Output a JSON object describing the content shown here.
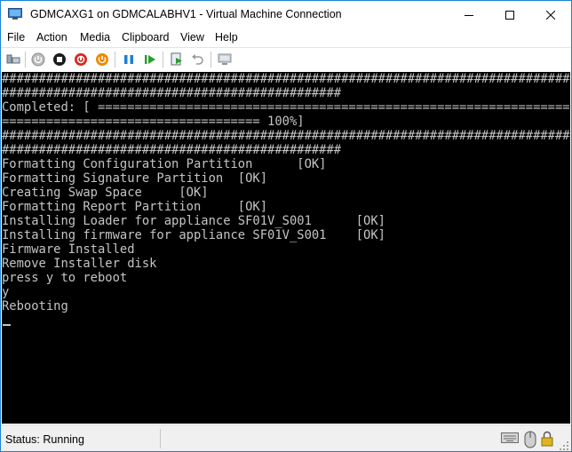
{
  "window": {
    "title": "GDMCAXG1 on GDMCALABHV1 - Virtual Machine Connection",
    "accent": "#1883d7"
  },
  "menu": {
    "items": [
      "File",
      "Action",
      "Media",
      "Clipboard",
      "View",
      "Help"
    ]
  },
  "toolbar": {
    "icons": [
      "ctrl-alt-del-icon",
      "start-icon",
      "turn-off-icon",
      "shutdown-icon",
      "save-icon",
      "pause-icon",
      "resume-icon",
      "checkpoint-icon",
      "revert-icon",
      "enhanced-session-icon"
    ]
  },
  "console": {
    "lines": [
      "################################################################################",
      "##############################################",
      "Completed: [ =====================================================================",
      "=================================== 100%]",
      "################################################################################",
      "##############################################",
      "Formatting Configuration Partition      [OK]",
      "Formatting Signature Partition  [OK]",
      "Creating Swap Space     [OK]",
      "Formatting Report Partition     [OK]",
      "Installing Loader for appliance SF01V_S001      [OK]",
      "Installing firmware for appliance SF01V_S001    [OK]",
      "Firmware Installed",
      "Remove Installer disk",
      "press y to reboot",
      "y",
      "Rebooting"
    ]
  },
  "status": {
    "text": "Status: Running"
  }
}
